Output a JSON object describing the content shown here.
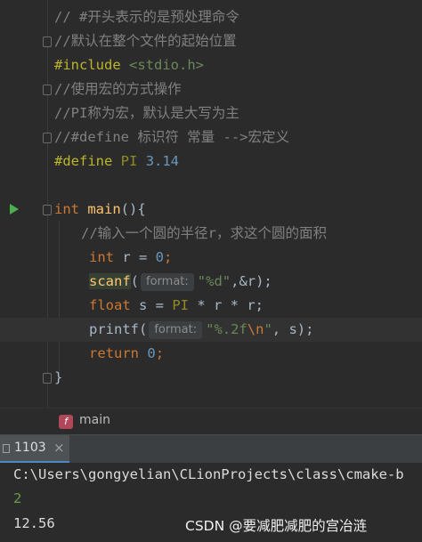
{
  "editor": {
    "lines": {
      "l1": "// #开头表示的是预处理命令",
      "l2": "//默认在整个文件的起始位置",
      "l3_directive": "#include",
      "l3_header": "<stdio.h>",
      "l4": "//使用宏的方式操作",
      "l5": "//PI称为宏，默认是大写为主",
      "l6": "//#define 标识符 常量 -->宏定义",
      "l7_directive": "#define",
      "l7_name": "PI",
      "l7_value": "3.14",
      "l9_kw": "int",
      "l9_fn": "main",
      "l9_rest": "(){",
      "l10": "//输入一个圆的半径r，求这个圆的面积",
      "l11_kw": "int",
      "l11_rest": " r = ",
      "l11_num": "0",
      "l11_end": ";",
      "l12_fn": "scanf",
      "l12_open": "(",
      "l12_hint": "format:",
      "l12_str": "\"%d\"",
      "l12_rest": ",&r);",
      "l13_kw": "float",
      "l13_rest": " s = ",
      "l13_macro": "PI",
      "l13_end": " * r * r;",
      "l14_fn": "printf",
      "l14_open": "(",
      "l14_hint": "format:",
      "l14_str1": "\"%.2f",
      "l14_esc": "\\n",
      "l14_str2": "\"",
      "l14_rest": ", s);",
      "l15_kw": "return",
      "l15_num": "0",
      "l15_end": ";",
      "l16": "}"
    }
  },
  "breadcrumb": {
    "icon_letter": "f",
    "label": "main"
  },
  "run_panel": {
    "tab_label": "1103",
    "close_glyph": "×"
  },
  "console": {
    "path": "C:\\Users\\gongyelian\\CLionProjects\\class\\cmake-b",
    "input": "2",
    "output": "12.56"
  },
  "watermark": "CSDN @要减肥减肥的宫冶涟",
  "colors": {
    "background": "#2b2b2b",
    "comment": "#808080",
    "keyword": "#cc7832",
    "function": "#ffc66d",
    "number": "#6897bb",
    "string": "#6a8759",
    "preprocessor": "#bbb529",
    "run_icon": "#4caf50",
    "console_input": "#6a9c4a"
  },
  "icons": {
    "run": "run-triangle-icon",
    "fold": "fold-marker-icon",
    "function_badge": "function-icon",
    "console_tab": "console-icon"
  }
}
